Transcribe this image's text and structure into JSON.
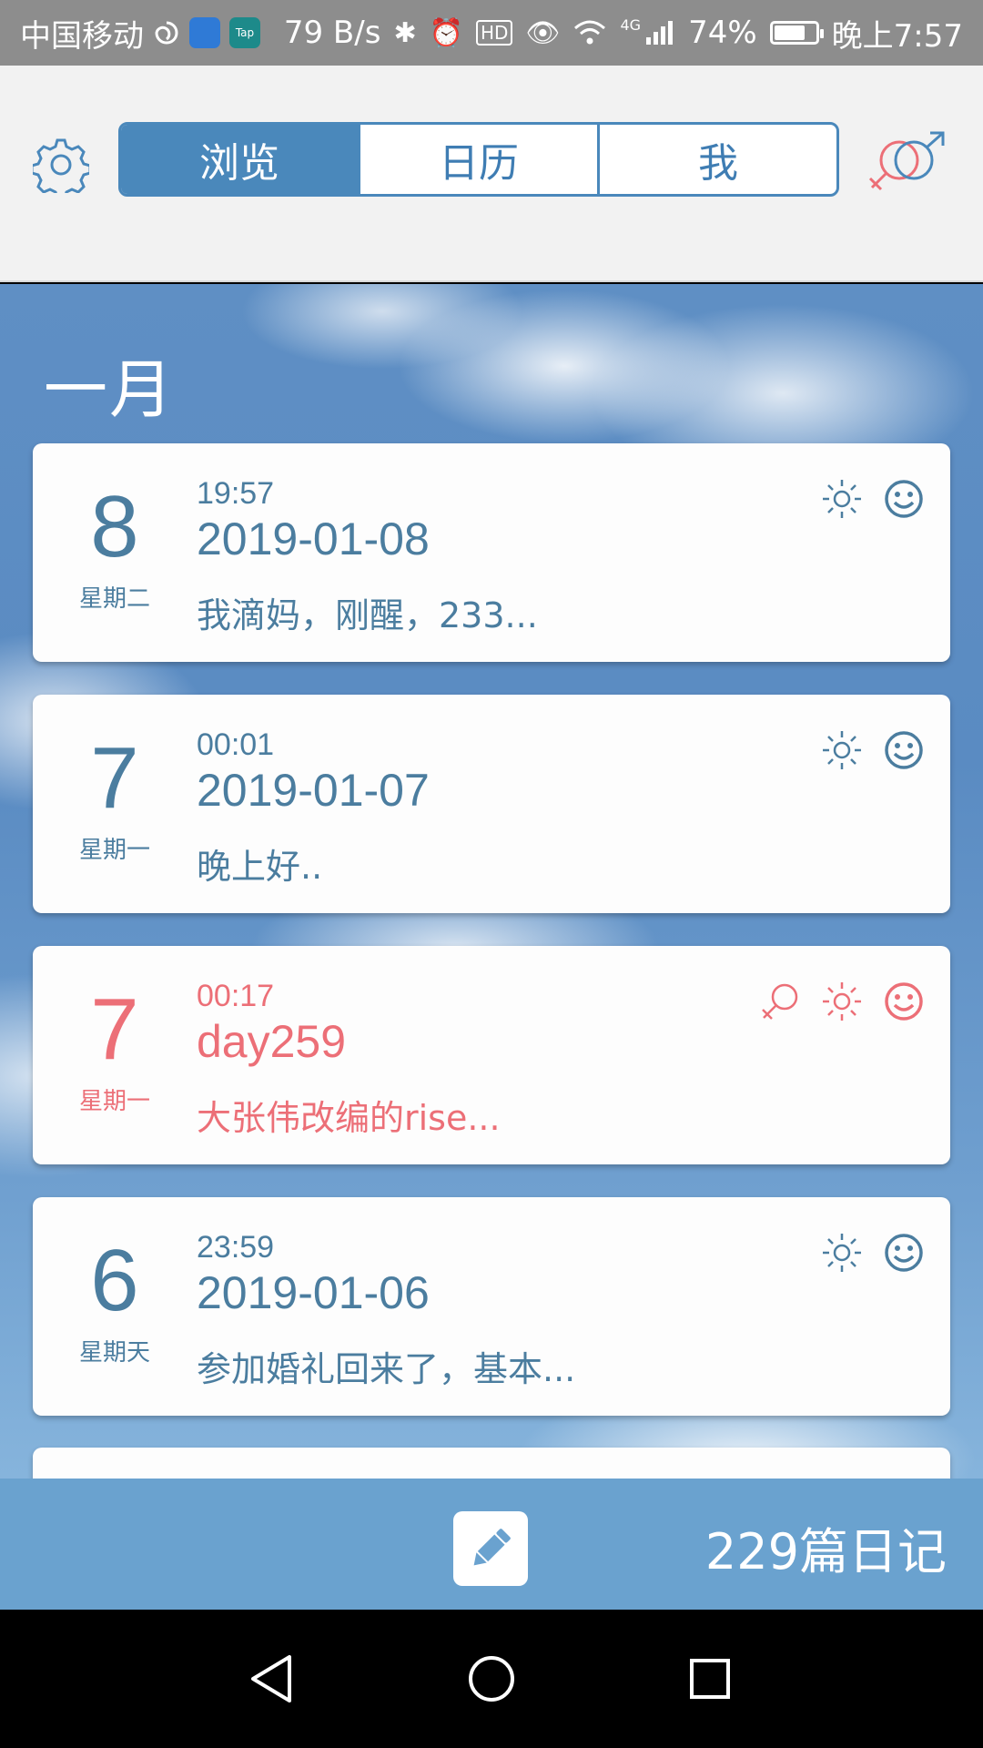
{
  "status_bar": {
    "carrier": "中国移动",
    "speed": "79 B/s",
    "network": "4G",
    "battery": "74%",
    "battery_level": 0.74,
    "time": "晚上7:57",
    "icons": [
      "swirl-icon",
      "shield-app-icon",
      "taptap-app-icon",
      "bluetooth-icon",
      "alarm-icon",
      "hd-icon",
      "eye-icon",
      "wifi-icon",
      "signal-icon",
      "battery-icon"
    ],
    "tap_label": "Tap"
  },
  "header": {
    "tabs": [
      {
        "label": "浏览",
        "active": true
      },
      {
        "label": "日历",
        "active": false
      },
      {
        "label": "我",
        "active": false
      }
    ],
    "settings_icon": "gear-icon",
    "gender_icon": "gender-icon"
  },
  "month_label": "一月",
  "entries": [
    {
      "day": "8",
      "weekday": "星期二",
      "time": "19:57",
      "title": "2019-01-08",
      "snippet": "我滴妈，刚醒，233...",
      "highlight": false,
      "icons": [
        "sun-icon",
        "smiley-icon"
      ]
    },
    {
      "day": "7",
      "weekday": "星期一",
      "time": "00:01",
      "title": "2019-01-07",
      "snippet": "晚上好..",
      "highlight": false,
      "icons": [
        "sun-icon",
        "smiley-icon"
      ]
    },
    {
      "day": "7",
      "weekday": "星期一",
      "time": "00:17",
      "title": "day259",
      "snippet": "大张伟改编的rise...",
      "highlight": true,
      "icons": [
        "female-icon",
        "sun-icon",
        "smiley-icon"
      ]
    },
    {
      "day": "6",
      "weekday": "星期天",
      "time": "23:59",
      "title": "2019-01-06",
      "snippet": "参加婚礼回来了，基本...",
      "highlight": false,
      "icons": [
        "sun-icon",
        "smiley-icon"
      ]
    }
  ],
  "bottom_bar": {
    "write_icon": "pencil-icon",
    "count": "229篇日记"
  },
  "nav_bar": {
    "icons": [
      "back-icon",
      "home-icon",
      "recents-icon"
    ]
  },
  "colors": {
    "accent_blue": "#4a88bb",
    "text_blue": "#4b7d9f",
    "pink": "#ec6f77",
    "bottom_bar": "#6aa2cf"
  }
}
